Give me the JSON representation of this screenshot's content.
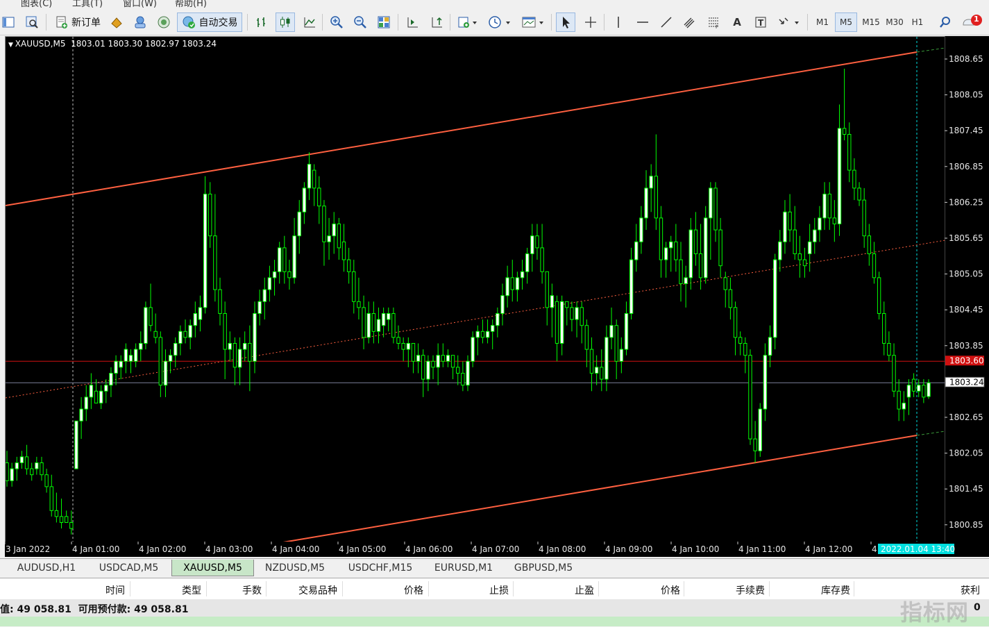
{
  "menu": [
    "图表(C)",
    "工具(T)",
    "窗口(W)",
    "帮助(H)"
  ],
  "toolbar": {
    "new_order_label": "新订单",
    "auto_trading_label": "自动交易",
    "timeframes": [
      "M1",
      "M5",
      "M15",
      "M30",
      "H1"
    ],
    "active_timeframe": "M5",
    "notification_count": "1"
  },
  "chart": {
    "header": "XAUUSD,M5  1803.01 1803.30 1802.97 1803.24",
    "price_labels": [
      "1808.65",
      "1808.05",
      "1807.45",
      "1806.85",
      "1806.25",
      "1805.65",
      "1805.05",
      "1804.45",
      "1803.85",
      "1802.65",
      "1802.05",
      "1801.45",
      "1800.85"
    ],
    "red_line_price": "1803.60",
    "current_price": "1803.24",
    "time_labels": [
      "3 Jan 2022",
      "4 Jan 01:00",
      "4 Jan 02:00",
      "4 Jan 03:00",
      "4 Jan 04:00",
      "4 Jan 05:00",
      "4 Jan 06:00",
      "4 Jan 07:00",
      "4 Jan 08:00",
      "4 Jan 09:00",
      "4 Jan 10:00",
      "4 Jan 11:00",
      "4 Jan 12:00",
      "4"
    ],
    "cursor_time": "2022.01.04 13:40",
    "colors": {
      "background": "#000000",
      "candle": "#00ff00",
      "bull_body": "#ffffff",
      "channel": "#ff6040",
      "red_line": "#d01010",
      "bid_line": "#7a7f99",
      "cursor": "#00e0e0"
    }
  },
  "chart_data": {
    "type": "candlestick",
    "symbol": "XAUUSD",
    "timeframe": "M5",
    "ylim": [
      1800.6,
      1809.0
    ],
    "candles": [
      [
        1801.9,
        1802.1,
        1801.5,
        1801.6
      ],
      [
        1801.6,
        1801.9,
        1801.5,
        1801.8
      ],
      [
        1801.8,
        1802.0,
        1801.6,
        1801.9
      ],
      [
        1801.9,
        1802.1,
        1801.8,
        1802.0
      ],
      [
        1802.0,
        1802.2,
        1801.7,
        1801.8
      ],
      [
        1801.8,
        1801.9,
        1801.6,
        1801.7
      ],
      [
        1801.8,
        1802.0,
        1801.7,
        1801.9
      ],
      [
        1801.9,
        1802.0,
        1801.6,
        1801.7
      ],
      [
        1801.7,
        1801.8,
        1801.4,
        1801.5
      ],
      [
        1801.5,
        1801.7,
        1801.0,
        1801.1
      ],
      [
        1801.1,
        1801.4,
        1800.9,
        1801.0
      ],
      [
        1801.0,
        1801.3,
        1800.8,
        1800.9
      ],
      [
        1801.0,
        1801.1,
        1800.9,
        1800.9
      ],
      [
        1800.9,
        1801.1,
        1800.7,
        1800.8
      ],
      [
        1801.8,
        1802.6,
        1801.8,
        1802.6
      ],
      [
        1802.6,
        1803.0,
        1802.3,
        1802.8
      ],
      [
        1802.8,
        1803.2,
        1802.6,
        1803.0
      ],
      [
        1803.0,
        1803.4,
        1802.8,
        1803.2
      ],
      [
        1803.1,
        1803.3,
        1802.9,
        1802.9
      ],
      [
        1802.9,
        1803.2,
        1802.8,
        1803.1
      ],
      [
        1803.1,
        1803.3,
        1802.9,
        1803.2
      ],
      [
        1803.2,
        1803.5,
        1803.0,
        1803.4
      ],
      [
        1803.4,
        1803.7,
        1803.2,
        1803.6
      ],
      [
        1803.5,
        1803.7,
        1803.3,
        1803.6
      ],
      [
        1803.6,
        1803.9,
        1803.4,
        1803.8
      ],
      [
        1803.6,
        1803.8,
        1803.4,
        1803.7
      ],
      [
        1803.6,
        1803.9,
        1803.5,
        1803.8
      ],
      [
        1803.8,
        1804.1,
        1803.6,
        1803.9
      ],
      [
        1803.9,
        1804.6,
        1803.8,
        1804.5
      ],
      [
        1804.5,
        1804.9,
        1804.1,
        1804.2
      ],
      [
        1804.1,
        1804.4,
        1803.9,
        1804.0
      ],
      [
        1804.0,
        1804.1,
        1803.0,
        1803.2
      ],
      [
        1803.2,
        1803.8,
        1803.0,
        1803.6
      ],
      [
        1803.6,
        1803.8,
        1803.4,
        1803.7
      ],
      [
        1803.7,
        1804.0,
        1803.5,
        1803.9
      ],
      [
        1803.9,
        1804.2,
        1803.7,
        1804.1
      ],
      [
        1804.1,
        1804.3,
        1803.9,
        1804.0
      ],
      [
        1804.0,
        1804.3,
        1803.8,
        1804.2
      ],
      [
        1804.2,
        1804.6,
        1804.0,
        1804.4
      ],
      [
        1804.3,
        1804.7,
        1804.1,
        1804.5
      ],
      [
        1804.5,
        1806.7,
        1804.4,
        1806.4
      ],
      [
        1806.4,
        1806.6,
        1805.5,
        1805.7
      ],
      [
        1805.7,
        1806.4,
        1804.6,
        1804.8
      ],
      [
        1804.8,
        1805.0,
        1804.2,
        1804.4
      ],
      [
        1804.4,
        1804.6,
        1803.3,
        1803.8
      ],
      [
        1803.8,
        1804.1,
        1803.6,
        1803.9
      ],
      [
        1803.9,
        1804.0,
        1803.2,
        1803.5
      ],
      [
        1803.5,
        1804.0,
        1803.2,
        1803.8
      ],
      [
        1803.8,
        1804.1,
        1803.6,
        1803.9
      ],
      [
        1803.9,
        1804.2,
        1803.1,
        1803.6
      ],
      [
        1803.6,
        1804.6,
        1803.4,
        1804.4
      ],
      [
        1804.4,
        1804.8,
        1804.2,
        1804.6
      ],
      [
        1804.6,
        1805.0,
        1804.3,
        1804.8
      ],
      [
        1804.8,
        1805.2,
        1804.6,
        1805.0
      ],
      [
        1805.0,
        1805.3,
        1804.7,
        1805.1
      ],
      [
        1805.1,
        1805.6,
        1804.9,
        1805.5
      ],
      [
        1805.5,
        1805.7,
        1804.9,
        1805.1
      ],
      [
        1805.1,
        1805.3,
        1804.8,
        1805.0
      ],
      [
        1805.0,
        1806.0,
        1804.9,
        1805.7
      ],
      [
        1805.7,
        1806.3,
        1805.4,
        1806.1
      ],
      [
        1806.1,
        1806.6,
        1805.9,
        1806.5
      ],
      [
        1806.5,
        1807.1,
        1806.3,
        1806.9
      ],
      [
        1806.8,
        1806.9,
        1806.2,
        1806.5
      ],
      [
        1806.5,
        1806.7,
        1805.9,
        1806.2
      ],
      [
        1806.2,
        1806.3,
        1805.2,
        1805.6
      ],
      [
        1805.6,
        1806.0,
        1805.3,
        1805.7
      ],
      [
        1805.7,
        1806.1,
        1805.4,
        1805.9
      ],
      [
        1805.9,
        1806.0,
        1805.3,
        1805.5
      ],
      [
        1805.6,
        1805.9,
        1805.1,
        1805.3
      ],
      [
        1805.3,
        1805.5,
        1804.9,
        1805.1
      ],
      [
        1805.1,
        1805.3,
        1804.4,
        1804.6
      ],
      [
        1804.6,
        1805.0,
        1804.3,
        1804.5
      ],
      [
        1804.5,
        1804.7,
        1803.8,
        1804.0
      ],
      [
        1804.0,
        1804.6,
        1803.9,
        1804.4
      ],
      [
        1804.4,
        1804.6,
        1803.9,
        1804.1
      ],
      [
        1804.1,
        1804.5,
        1803.9,
        1804.3
      ],
      [
        1804.2,
        1804.5,
        1804.0,
        1804.4
      ],
      [
        1804.3,
        1804.5,
        1804.1,
        1804.4
      ],
      [
        1804.4,
        1804.5,
        1803.9,
        1804.0
      ],
      [
        1804.0,
        1804.2,
        1803.8,
        1803.9
      ],
      [
        1803.9,
        1804.0,
        1803.6,
        1803.8
      ],
      [
        1803.8,
        1804.0,
        1803.5,
        1803.9
      ],
      [
        1803.9,
        1803.9,
        1803.4,
        1803.6
      ],
      [
        1803.6,
        1803.9,
        1803.4,
        1803.7
      ],
      [
        1803.7,
        1803.8,
        1803.0,
        1803.3
      ],
      [
        1803.3,
        1803.7,
        1803.1,
        1803.6
      ],
      [
        1803.6,
        1803.7,
        1803.3,
        1803.5
      ],
      [
        1803.5,
        1803.9,
        1803.2,
        1803.7
      ],
      [
        1803.7,
        1803.9,
        1803.5,
        1803.6
      ],
      [
        1803.6,
        1803.8,
        1803.5,
        1803.7
      ],
      [
        1803.7,
        1803.7,
        1803.3,
        1803.5
      ],
      [
        1803.5,
        1803.7,
        1803.2,
        1803.4
      ],
      [
        1803.4,
        1803.6,
        1803.1,
        1803.2
      ],
      [
        1803.2,
        1803.7,
        1803.1,
        1803.6
      ],
      [
        1803.6,
        1804.1,
        1803.5,
        1804.0
      ],
      [
        1804.0,
        1804.2,
        1803.7,
        1804.1
      ],
      [
        1804.1,
        1804.3,
        1803.9,
        1804.0
      ],
      [
        1804.0,
        1804.3,
        1803.9,
        1804.1
      ],
      [
        1804.1,
        1804.3,
        1803.8,
        1804.2
      ],
      [
        1804.2,
        1804.5,
        1804.0,
        1804.4
      ],
      [
        1804.4,
        1804.9,
        1804.2,
        1804.7
      ],
      [
        1804.7,
        1805.2,
        1804.5,
        1805.0
      ],
      [
        1805.0,
        1805.3,
        1804.6,
        1804.8
      ],
      [
        1804.8,
        1805.1,
        1804.6,
        1805.0
      ],
      [
        1805.0,
        1805.3,
        1804.8,
        1805.1
      ],
      [
        1805.1,
        1805.5,
        1804.9,
        1805.4
      ],
      [
        1805.4,
        1805.9,
        1805.1,
        1805.7
      ],
      [
        1805.7,
        1805.9,
        1805.3,
        1805.5
      ],
      [
        1805.5,
        1805.9,
        1804.9,
        1805.1
      ],
      [
        1805.1,
        1805.1,
        1804.2,
        1804.5
      ],
      [
        1804.5,
        1804.9,
        1804.0,
        1804.7
      ],
      [
        1804.6,
        1804.7,
        1803.6,
        1803.9
      ],
      [
        1803.9,
        1804.7,
        1803.7,
        1804.6
      ],
      [
        1804.6,
        1804.6,
        1804.2,
        1804.5
      ],
      [
        1804.5,
        1804.6,
        1804.1,
        1804.3
      ],
      [
        1804.3,
        1804.6,
        1804.0,
        1804.5
      ],
      [
        1804.5,
        1804.6,
        1803.9,
        1804.2
      ],
      [
        1804.2,
        1804.3,
        1803.5,
        1803.8
      ],
      [
        1803.8,
        1804.0,
        1803.1,
        1803.4
      ],
      [
        1803.4,
        1803.7,
        1803.2,
        1803.5
      ],
      [
        1803.5,
        1803.8,
        1803.1,
        1803.3
      ],
      [
        1803.3,
        1804.2,
        1803.1,
        1804.0
      ],
      [
        1804.0,
        1804.5,
        1803.8,
        1804.2
      ],
      [
        1804.2,
        1804.3,
        1803.3,
        1803.6
      ],
      [
        1803.6,
        1804.0,
        1803.4,
        1803.8
      ],
      [
        1803.8,
        1804.6,
        1803.7,
        1804.4
      ],
      [
        1804.4,
        1805.5,
        1804.3,
        1805.3
      ],
      [
        1805.3,
        1805.9,
        1805.1,
        1805.6
      ],
      [
        1805.6,
        1806.2,
        1805.4,
        1806.0
      ],
      [
        1806.0,
        1806.8,
        1805.8,
        1806.5
      ],
      [
        1806.5,
        1806.9,
        1806.1,
        1806.7
      ],
      [
        1806.7,
        1807.4,
        1805.8,
        1806.0
      ],
      [
        1806.0,
        1806.2,
        1805.0,
        1805.3
      ],
      [
        1805.3,
        1805.6,
        1805.0,
        1805.5
      ],
      [
        1805.5,
        1805.7,
        1805.1,
        1805.6
      ],
      [
        1805.6,
        1805.9,
        1805.1,
        1805.3
      ],
      [
        1805.3,
        1805.6,
        1804.6,
        1804.9
      ],
      [
        1804.9,
        1805.2,
        1804.5,
        1805.0
      ],
      [
        1805.0,
        1806.0,
        1804.8,
        1805.8
      ],
      [
        1805.8,
        1806.1,
        1805.2,
        1805.4
      ],
      [
        1805.4,
        1805.9,
        1804.8,
        1805.0
      ],
      [
        1805.0,
        1806.2,
        1804.9,
        1806.0
      ],
      [
        1806.0,
        1806.6,
        1805.3,
        1806.5
      ],
      [
        1806.5,
        1806.6,
        1805.6,
        1805.8
      ],
      [
        1805.8,
        1806.0,
        1805.0,
        1805.2
      ],
      [
        1805.0,
        1805.1,
        1804.5,
        1804.8
      ],
      [
        1804.8,
        1805.0,
        1804.3,
        1804.5
      ],
      [
        1804.5,
        1804.6,
        1803.7,
        1804.0
      ],
      [
        1804.0,
        1804.1,
        1803.7,
        1803.9
      ],
      [
        1803.9,
        1804.0,
        1803.4,
        1803.7
      ],
      [
        1803.7,
        1803.8,
        1802.2,
        1802.3
      ],
      [
        1802.3,
        1802.6,
        1801.9,
        1802.1
      ],
      [
        1802.1,
        1802.9,
        1802.0,
        1802.8
      ],
      [
        1802.8,
        1803.9,
        1802.6,
        1803.7
      ],
      [
        1803.7,
        1804.2,
        1803.5,
        1804.0
      ],
      [
        1804.0,
        1805.4,
        1803.8,
        1805.3
      ],
      [
        1805.3,
        1805.8,
        1805.1,
        1805.6
      ],
      [
        1805.6,
        1806.3,
        1805.4,
        1806.1
      ],
      [
        1806.1,
        1806.4,
        1805.6,
        1805.8
      ],
      [
        1805.8,
        1806.2,
        1805.3,
        1805.4
      ],
      [
        1805.4,
        1805.7,
        1805.0,
        1805.3
      ],
      [
        1805.3,
        1805.5,
        1805.0,
        1805.2
      ],
      [
        1805.4,
        1805.9,
        1805.1,
        1805.6
      ],
      [
        1805.6,
        1806.0,
        1805.4,
        1805.8
      ],
      [
        1805.8,
        1806.2,
        1805.6,
        1806.0
      ],
      [
        1806.0,
        1806.6,
        1805.8,
        1806.4
      ],
      [
        1806.4,
        1806.6,
        1805.8,
        1806.0
      ],
      [
        1806.0,
        1806.3,
        1805.6,
        1805.9
      ],
      [
        1805.9,
        1807.9,
        1805.7,
        1807.5
      ],
      [
        1807.5,
        1808.5,
        1807.3,
        1807.4
      ],
      [
        1807.4,
        1807.6,
        1806.6,
        1806.8
      ],
      [
        1806.8,
        1807.0,
        1806.3,
        1806.5
      ],
      [
        1806.5,
        1806.6,
        1806.2,
        1806.3
      ],
      [
        1806.3,
        1806.5,
        1805.5,
        1805.7
      ],
      [
        1805.7,
        1805.9,
        1805.2,
        1805.4
      ],
      [
        1805.4,
        1805.6,
        1804.9,
        1805.0
      ],
      [
        1805.0,
        1805.1,
        1804.3,
        1804.4
      ],
      [
        1804.4,
        1804.6,
        1803.7,
        1803.9
      ],
      [
        1803.9,
        1804.1,
        1803.6,
        1803.7
      ],
      [
        1803.7,
        1803.9,
        1803.0,
        1803.1
      ],
      [
        1803.1,
        1803.3,
        1802.6,
        1802.8
      ],
      [
        1802.8,
        1803.1,
        1802.6,
        1802.9
      ],
      [
        1803.0,
        1803.3,
        1802.7,
        1803.2
      ],
      [
        1803.3,
        1803.4,
        1803.0,
        1803.1
      ],
      [
        1803.1,
        1803.3,
        1803.0,
        1803.2
      ],
      [
        1803.2,
        1803.3,
        1802.9,
        1803.0
      ],
      [
        1803.01,
        1803.3,
        1802.97,
        1803.24
      ]
    ]
  },
  "tabs": [
    "AUDUSD,H1",
    "USDCAD,M5",
    "XAUUSD,M5",
    "NZDUSD,M5",
    "USDCHF,M15",
    "EURUSD,M1",
    "GBPUSD,M5"
  ],
  "active_tab": "XAUUSD,M5",
  "terminal": {
    "columns": [
      "时间",
      "类型",
      "手数",
      "交易品种",
      "价格",
      "止损",
      "止盈",
      "价格",
      "手续费",
      "库存费",
      "获利"
    ],
    "balance_text": "值: 49 058.81  可用预付款: 49 058.81",
    "balance_end": "0",
    "watermark": "指标网"
  }
}
